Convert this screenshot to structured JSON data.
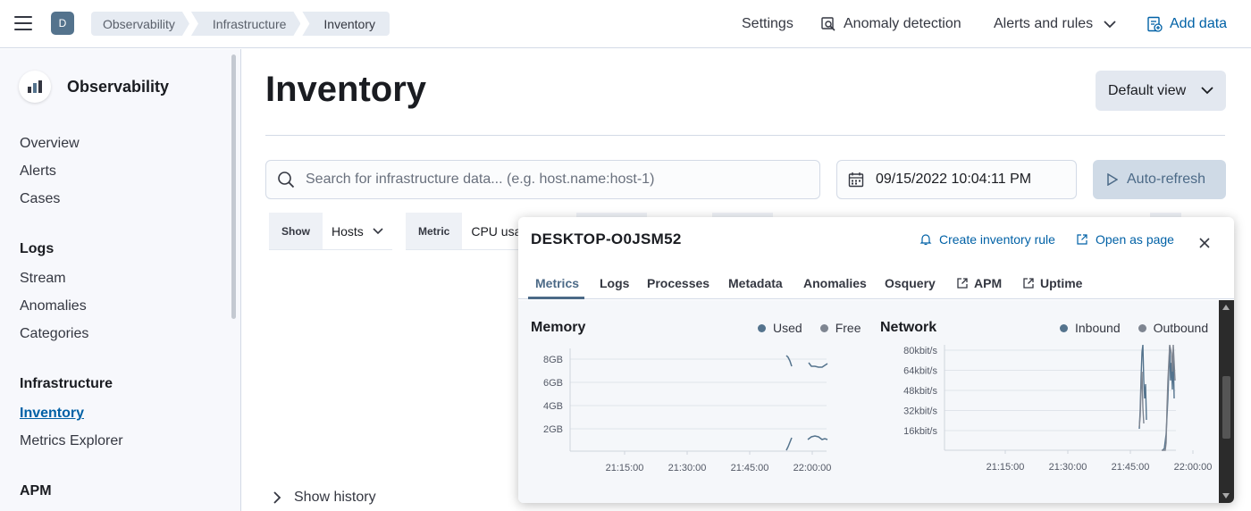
{
  "header": {
    "avatar_initial": "D",
    "breadcrumbs": [
      "Observability",
      "Infrastructure",
      "Inventory"
    ],
    "nav": {
      "settings": "Settings",
      "anomaly_detection": "Anomaly detection",
      "alerts_rules": "Alerts and rules",
      "add_data": "Add data"
    }
  },
  "sidebar": {
    "title": "Observability",
    "items_top": [
      "Overview",
      "Alerts",
      "Cases"
    ],
    "logs_header": "Logs",
    "logs_items": [
      "Stream",
      "Anomalies",
      "Categories"
    ],
    "infra_header": "Infrastructure",
    "infra_items": [
      "Inventory",
      "Metrics Explorer"
    ],
    "apm_header": "APM"
  },
  "main": {
    "title": "Inventory",
    "view_button": "Default view",
    "search_placeholder": "Search for infrastructure data... (e.g. host.name:host-1)",
    "date": "09/15/2022 10:04:11 PM",
    "refresh_label": "Auto-refresh",
    "show_label": "Show",
    "show_value": "Hosts",
    "metric_label": "Metric",
    "metric_value": "CPU usa",
    "show_history": "Show history"
  },
  "flyout": {
    "host": "DESKTOP-O0JSM52",
    "create_rule": "Create inventory rule",
    "open_page": "Open as page",
    "tabs": [
      "Metrics",
      "Logs",
      "Processes",
      "Metadata",
      "Anomalies",
      "Osquery",
      "APM",
      "Uptime"
    ],
    "active_tab": "Metrics"
  },
  "chart_data": [
    {
      "type": "line",
      "title": "Memory",
      "series": [
        {
          "name": "Used",
          "color": "#54738d"
        },
        {
          "name": "Free",
          "color": "#7e8591"
        }
      ],
      "y_ticks": [
        "8GB",
        "6GB",
        "4GB",
        "2GB"
      ],
      "x_ticks": [
        "21:15:00",
        "21:30:00",
        "21:45:00",
        "22:00:00"
      ]
    },
    {
      "type": "line",
      "title": "Network",
      "series": [
        {
          "name": "Inbound",
          "color": "#54738d"
        },
        {
          "name": "Outbound",
          "color": "#7e8591"
        }
      ],
      "y_ticks": [
        "80kbit/s",
        "64kbit/s",
        "48kbit/s",
        "32kbit/s",
        "16kbit/s"
      ],
      "x_ticks": [
        "21:15:00",
        "21:30:00",
        "21:45:00",
        "22:00:00"
      ]
    }
  ]
}
